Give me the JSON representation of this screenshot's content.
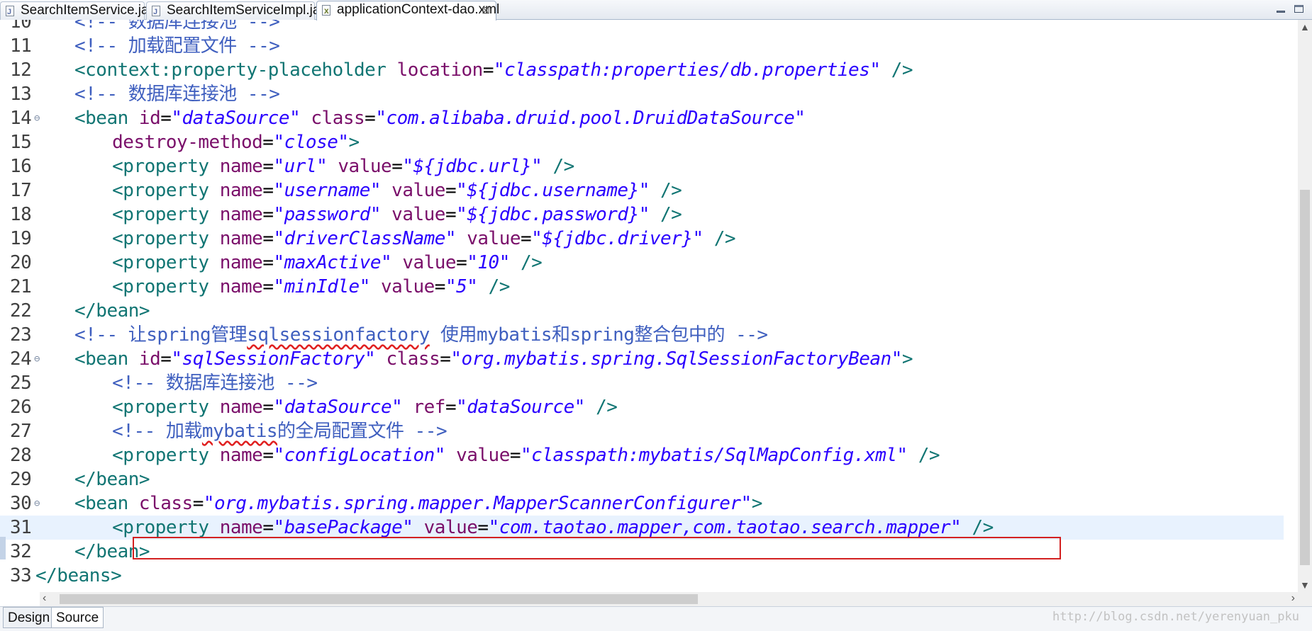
{
  "tabs": [
    {
      "label": "SearchItemService.java",
      "icon": "java-file-icon",
      "active": false
    },
    {
      "label": "SearchItemServiceImpl.java",
      "icon": "java-file-icon",
      "active": false
    },
    {
      "label": "applicationContext-dao.xml",
      "icon": "xml-file-icon",
      "active": true,
      "close": "⊠"
    }
  ],
  "editor": {
    "current_line": "31",
    "lines": [
      {
        "n": "10",
        "t": [
          [
            "t-cmt",
            "<!-- 数据库连接池 -->"
          ]
        ]
      },
      {
        "n": "11",
        "t": [
          [
            "t-cmt",
            "<!-- 加载配置文件 -->"
          ]
        ]
      },
      {
        "n": "12",
        "t": [
          [
            "t-tag",
            "<context:property-placeholder "
          ],
          [
            "t-attr",
            "location"
          ],
          [
            "t-eq",
            "="
          ],
          [
            "t-val",
            "\"classpath:properties/db.properties\""
          ],
          [
            "t-tag",
            " />"
          ]
        ]
      },
      {
        "n": "13",
        "t": [
          [
            "t-cmt",
            "<!-- 数据库连接池 -->"
          ]
        ]
      },
      {
        "n": "14",
        "fold": true,
        "t": [
          [
            "t-tag",
            "<bean "
          ],
          [
            "t-attr",
            "id"
          ],
          [
            "t-eq",
            "="
          ],
          [
            "t-val",
            "\"dataSource\""
          ],
          [
            "t-tag",
            " "
          ],
          [
            "t-attr",
            "class"
          ],
          [
            "t-eq",
            "="
          ],
          [
            "t-val",
            "\"com.alibaba.druid.pool.DruidDataSource\""
          ]
        ]
      },
      {
        "n": "15",
        "indent": 2,
        "t": [
          [
            "t-attr",
            "destroy-method"
          ],
          [
            "t-eq",
            "="
          ],
          [
            "t-val",
            "\"close\""
          ],
          [
            "t-tag",
            ">"
          ]
        ]
      },
      {
        "n": "16",
        "indent": 2,
        "t": [
          [
            "t-tag",
            "<property "
          ],
          [
            "t-attr",
            "name"
          ],
          [
            "t-eq",
            "="
          ],
          [
            "t-val",
            "\"url\""
          ],
          [
            "t-tag",
            " "
          ],
          [
            "t-attr",
            "value"
          ],
          [
            "t-eq",
            "="
          ],
          [
            "t-val",
            "\"${jdbc.url}\""
          ],
          [
            "t-tag",
            " />"
          ]
        ]
      },
      {
        "n": "17",
        "indent": 2,
        "t": [
          [
            "t-tag",
            "<property "
          ],
          [
            "t-attr",
            "name"
          ],
          [
            "t-eq",
            "="
          ],
          [
            "t-val",
            "\"username\""
          ],
          [
            "t-tag",
            " "
          ],
          [
            "t-attr",
            "value"
          ],
          [
            "t-eq",
            "="
          ],
          [
            "t-val",
            "\"${jdbc.username}\""
          ],
          [
            "t-tag",
            " />"
          ]
        ]
      },
      {
        "n": "18",
        "indent": 2,
        "t": [
          [
            "t-tag",
            "<property "
          ],
          [
            "t-attr",
            "name"
          ],
          [
            "t-eq",
            "="
          ],
          [
            "t-val",
            "\"password\""
          ],
          [
            "t-tag",
            " "
          ],
          [
            "t-attr",
            "value"
          ],
          [
            "t-eq",
            "="
          ],
          [
            "t-val",
            "\"${jdbc.password}\""
          ],
          [
            "t-tag",
            " />"
          ]
        ]
      },
      {
        "n": "19",
        "indent": 2,
        "t": [
          [
            "t-tag",
            "<property "
          ],
          [
            "t-attr",
            "name"
          ],
          [
            "t-eq",
            "="
          ],
          [
            "t-val",
            "\"driverClassName\""
          ],
          [
            "t-tag",
            " "
          ],
          [
            "t-attr",
            "value"
          ],
          [
            "t-eq",
            "="
          ],
          [
            "t-val",
            "\"${jdbc.driver}\""
          ],
          [
            "t-tag",
            " />"
          ]
        ]
      },
      {
        "n": "20",
        "indent": 2,
        "t": [
          [
            "t-tag",
            "<property "
          ],
          [
            "t-attr",
            "name"
          ],
          [
            "t-eq",
            "="
          ],
          [
            "t-val",
            "\"maxActive\""
          ],
          [
            "t-tag",
            " "
          ],
          [
            "t-attr",
            "value"
          ],
          [
            "t-eq",
            "="
          ],
          [
            "t-val",
            "\"10\""
          ],
          [
            "t-tag",
            " />"
          ]
        ]
      },
      {
        "n": "21",
        "indent": 2,
        "t": [
          [
            "t-tag",
            "<property "
          ],
          [
            "t-attr",
            "name"
          ],
          [
            "t-eq",
            "="
          ],
          [
            "t-val",
            "\"minIdle\""
          ],
          [
            "t-tag",
            " "
          ],
          [
            "t-attr",
            "value"
          ],
          [
            "t-eq",
            "="
          ],
          [
            "t-val",
            "\"5\""
          ],
          [
            "t-tag",
            " />"
          ]
        ]
      },
      {
        "n": "22",
        "t": [
          [
            "t-tag",
            "</bean>"
          ]
        ]
      },
      {
        "n": "23",
        "t": [
          [
            "t-cmt",
            "<!-- 让spring管理"
          ],
          [
            "t-cmt t-err",
            "sqlsessionfactory"
          ],
          [
            "t-cmt",
            " 使用mybatis和spring整合包中的 -->"
          ]
        ]
      },
      {
        "n": "24",
        "fold": true,
        "t": [
          [
            "t-tag",
            "<bean "
          ],
          [
            "t-attr",
            "id"
          ],
          [
            "t-eq",
            "="
          ],
          [
            "t-val",
            "\"sqlSessionFactory\""
          ],
          [
            "t-tag",
            " "
          ],
          [
            "t-attr",
            "class"
          ],
          [
            "t-eq",
            "="
          ],
          [
            "t-val",
            "\"org.mybatis.spring.SqlSessionFactoryBean\""
          ],
          [
            "t-tag",
            ">"
          ]
        ]
      },
      {
        "n": "25",
        "indent": 2,
        "t": [
          [
            "t-cmt",
            "<!-- 数据库连接池 -->"
          ]
        ]
      },
      {
        "n": "26",
        "indent": 2,
        "t": [
          [
            "t-tag",
            "<property "
          ],
          [
            "t-attr",
            "name"
          ],
          [
            "t-eq",
            "="
          ],
          [
            "t-val",
            "\"dataSource\""
          ],
          [
            "t-tag",
            " "
          ],
          [
            "t-attr",
            "ref"
          ],
          [
            "t-eq",
            "="
          ],
          [
            "t-val",
            "\"dataSource\""
          ],
          [
            "t-tag",
            " />"
          ]
        ]
      },
      {
        "n": "27",
        "indent": 2,
        "t": [
          [
            "t-cmt",
            "<!-- 加载"
          ],
          [
            "t-cmt t-err",
            "mybatis"
          ],
          [
            "t-cmt",
            "的全局配置文件 -->"
          ]
        ]
      },
      {
        "n": "28",
        "indent": 2,
        "t": [
          [
            "t-tag",
            "<property "
          ],
          [
            "t-attr",
            "name"
          ],
          [
            "t-eq",
            "="
          ],
          [
            "t-val",
            "\"configLocation\""
          ],
          [
            "t-tag",
            " "
          ],
          [
            "t-attr",
            "value"
          ],
          [
            "t-eq",
            "="
          ],
          [
            "t-val",
            "\"classpath:mybatis/SqlMapConfig.xml\""
          ],
          [
            "t-tag",
            " />"
          ]
        ]
      },
      {
        "n": "29",
        "t": [
          [
            "t-tag",
            "</bean>"
          ]
        ]
      },
      {
        "n": "30",
        "fold": true,
        "t": [
          [
            "t-tag",
            "<bean "
          ],
          [
            "t-attr",
            "class"
          ],
          [
            "t-eq",
            "="
          ],
          [
            "t-val",
            "\"org.mybatis.spring.mapper.MapperScannerConfigurer\""
          ],
          [
            "t-tag",
            ">"
          ]
        ]
      },
      {
        "n": "31",
        "indent": 2,
        "t": [
          [
            "t-tag",
            "<property "
          ],
          [
            "t-attr",
            "name"
          ],
          [
            "t-eq",
            "="
          ],
          [
            "t-val",
            "\"basePackage\""
          ],
          [
            "t-tag",
            " "
          ],
          [
            "t-attr",
            "value"
          ],
          [
            "t-eq",
            "="
          ],
          [
            "t-val",
            "\"com.taotao.mapper,com.taotao.search.mapper\""
          ],
          [
            "t-tag",
            " />"
          ]
        ]
      },
      {
        "n": "32",
        "t": [
          [
            "t-tag",
            "</bean>"
          ]
        ]
      },
      {
        "n": "33",
        "indent": 0,
        "t": [
          [
            "t-tag",
            "</beans>"
          ]
        ]
      }
    ]
  },
  "bottom_tabs": [
    {
      "label": "Design",
      "active": false
    },
    {
      "label": "Source",
      "active": true
    }
  ],
  "watermark": "http://blog.csdn.net/yerenyuan_pku",
  "colors": {
    "tag": "#117573",
    "attribute": "#7a0f6a",
    "value": "#2a00ff",
    "comment": "#3f5fbf",
    "current_line_bg": "#e8f2fe",
    "highlight_border": "#d32020"
  }
}
